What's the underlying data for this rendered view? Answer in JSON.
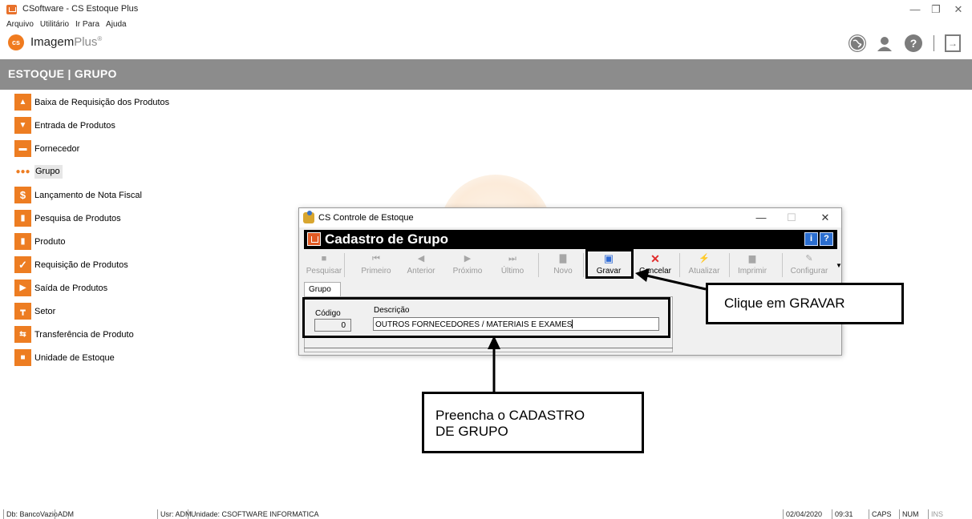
{
  "window": {
    "title": "CSoftware - CS Estoque Plus",
    "controls": [
      "—",
      "❐",
      "✕"
    ]
  },
  "menubar": [
    "Arquivo",
    "Utilitário",
    "Ir Para",
    "Ajuda"
  ],
  "brand": {
    "logo_text": "cs",
    "name": "Imagem",
    "name_suffix": "Plus",
    "mark": "®"
  },
  "top_icons": [
    "globe-icon",
    "user-icon",
    "help-icon",
    "exit-icon"
  ],
  "section": {
    "title": "ESTOQUE  |  GRUPO"
  },
  "menu": [
    {
      "label": "Baixa de Requisição dos Produtos",
      "icon": "box-up-icon"
    },
    {
      "label": "Entrada de Produtos",
      "icon": "box-in-icon"
    },
    {
      "label": "Fornecedor",
      "icon": "truck-icon"
    },
    {
      "label": "Grupo",
      "icon": "group-icon"
    },
    {
      "label": "Lançamento de Nota Fiscal",
      "icon": "dollar-icon"
    },
    {
      "label": "Pesquisa de Produtos",
      "icon": "cylinder-icon"
    },
    {
      "label": "Produto",
      "icon": "cylinder-icon"
    },
    {
      "label": "Requisição de Produtos",
      "icon": "check-icon"
    },
    {
      "label": "Saída de Produtos",
      "icon": "box-out-icon"
    },
    {
      "label": "Setor",
      "icon": "org-chart-icon"
    },
    {
      "label": "Transferência de Produto",
      "icon": "transfer-icon"
    },
    {
      "label": "Unidade de Estoque",
      "icon": "warehouse-icon"
    }
  ],
  "dialog": {
    "title": "CS Controle de Estoque",
    "header": "Cadastro de Grupo",
    "toolbar": [
      {
        "label": "Pesquisar",
        "enabled": false
      },
      {
        "label": "Primeiro",
        "enabled": false
      },
      {
        "label": "Anterior",
        "enabled": false
      },
      {
        "label": "Próximo",
        "enabled": false
      },
      {
        "label": "Último",
        "enabled": false
      },
      {
        "label": "Novo",
        "enabled": false
      },
      {
        "label": "Gravar",
        "enabled": true
      },
      {
        "label": "Cancelar",
        "enabled": true
      },
      {
        "label": "Atualizar",
        "enabled": false
      },
      {
        "label": "Imprimir",
        "enabled": false
      },
      {
        "label": "Configurar",
        "enabled": false
      }
    ],
    "tab": "Grupo",
    "fields": {
      "codigo_label": "Código",
      "codigo_value": "0",
      "descricao_label": "Descrição",
      "descricao_value": "OUTROS FORNECEDORES / MATERIAIS E EXAMES"
    }
  },
  "callouts": {
    "gravar": "Clique em GRAVAR",
    "cadastro_line1": "Preencha o CADASTRO",
    "cadastro_line2": "DE GRUPO"
  },
  "statusbar": {
    "db": "Db: BancoVazio",
    "user_short": "ADM",
    "user": "Usr: ADM",
    "unit": "Unidade: CSOFTWARE INFORMATICA",
    "date": "02/04/2020",
    "time": "09:31",
    "caps": "CAPS",
    "num": "NUM",
    "ins": "INS"
  },
  "colors": {
    "accent": "#ed7d22",
    "header_gray": "#8c8c8c",
    "dialog_header": "#000000"
  }
}
